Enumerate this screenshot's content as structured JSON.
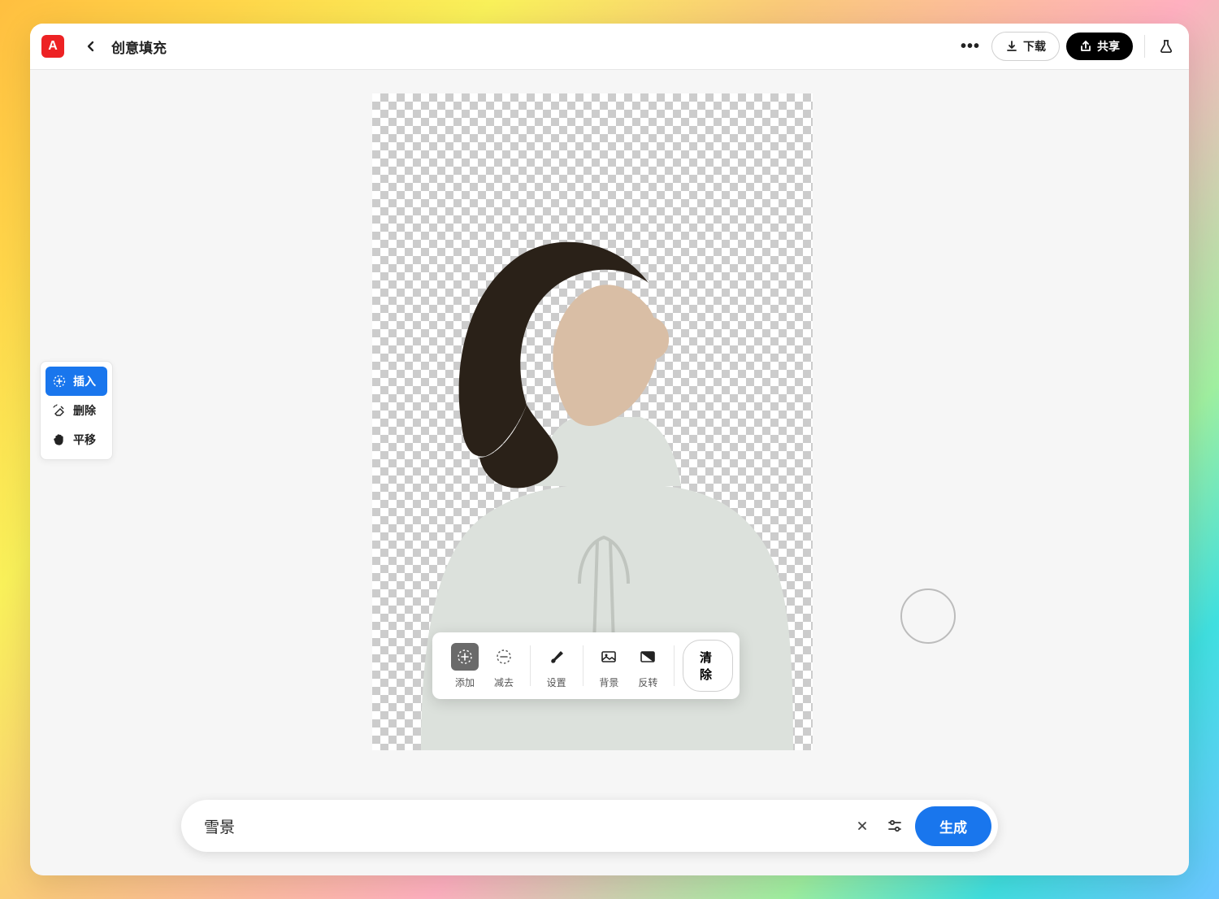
{
  "header": {
    "logo_letter": "A",
    "title": "创意填充",
    "download_label": "下载",
    "share_label": "共享"
  },
  "tools": {
    "insert": "插入",
    "remove": "删除",
    "pan": "平移"
  },
  "brushbar": {
    "add": "添加",
    "subtract": "减去",
    "settings": "设置",
    "background": "背景",
    "invert": "反转",
    "clear": "清除"
  },
  "prompt": {
    "value": "雪景",
    "generate": "生成"
  }
}
